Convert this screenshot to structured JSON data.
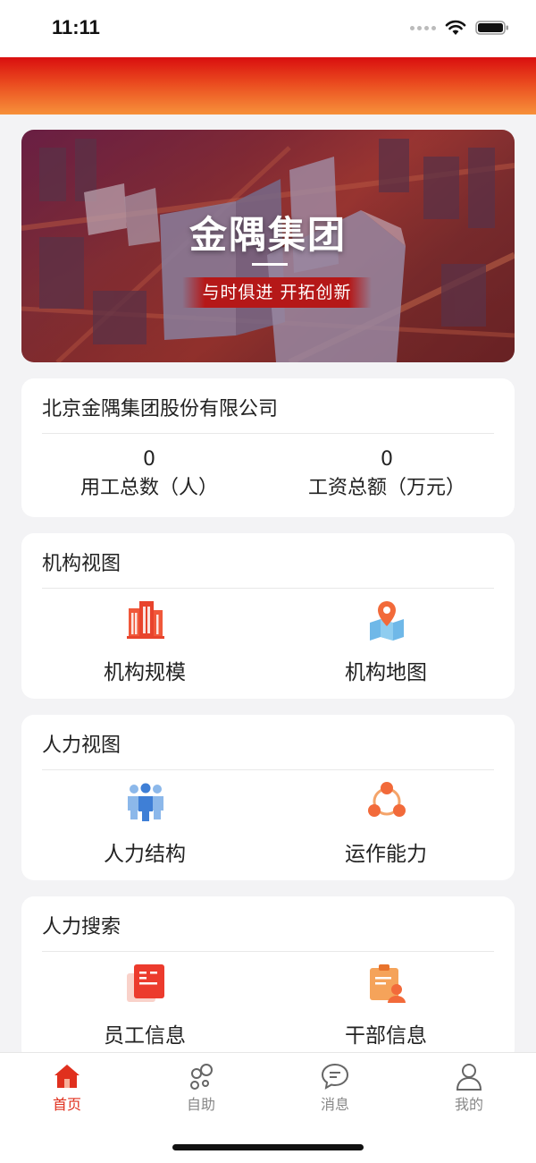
{
  "status_bar": {
    "time": "11:11"
  },
  "banner": {
    "title": "金隅集团",
    "slogan": "与时俱进  开拓创新"
  },
  "company": {
    "name": "北京金隅集团股份有限公司",
    "stats": [
      {
        "value": "0",
        "label": "用工总数（人）"
      },
      {
        "value": "0",
        "label": "工资总额（万元）"
      }
    ]
  },
  "sections": [
    {
      "title": "机构视图",
      "items": [
        {
          "label": "机构规模",
          "icon": "buildings-icon"
        },
        {
          "label": "机构地图",
          "icon": "map-pin-icon"
        }
      ]
    },
    {
      "title": "人力视图",
      "items": [
        {
          "label": "人力结构",
          "icon": "people-group-icon"
        },
        {
          "label": "运作能力",
          "icon": "network-nodes-icon"
        }
      ]
    },
    {
      "title": "人力搜索",
      "items": [
        {
          "label": "员工信息",
          "icon": "employee-card-icon"
        },
        {
          "label": "干部信息",
          "icon": "cadre-clipboard-icon"
        }
      ]
    }
  ],
  "tabbar": {
    "items": [
      {
        "label": "首页",
        "icon": "home-icon",
        "active": true
      },
      {
        "label": "自助",
        "icon": "self-service-icon",
        "active": false
      },
      {
        "label": "消息",
        "icon": "message-icon",
        "active": false
      },
      {
        "label": "我的",
        "icon": "profile-icon",
        "active": false
      }
    ]
  },
  "colors": {
    "accent": "#e0301e",
    "header_top": "#d90f0f",
    "header_bottom": "#f7913a",
    "tab_inactive": "#888888"
  }
}
